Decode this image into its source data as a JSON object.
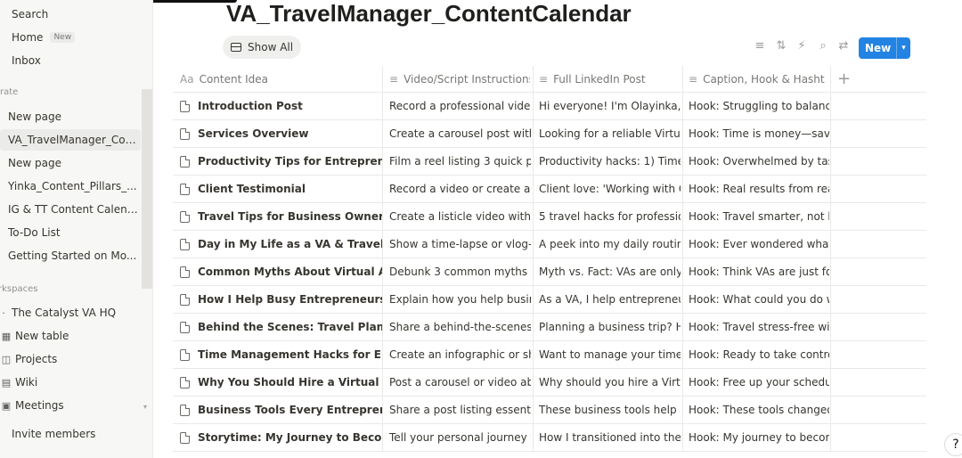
{
  "sidebar": {
    "search": "Search",
    "home": "Home",
    "home_badge": "New",
    "inbox": "Inbox",
    "private_section": "rate",
    "private_pages": [
      "New page",
      "VA_TravelManager_Con...",
      "New page",
      "Yinka_Content_Pillars_...",
      "IG & TT Content Calend...",
      "To-Do List",
      "Getting Started on Mo..."
    ],
    "workspaces_section": "rkspaces",
    "workspace_name": "The Catalyst VA HQ",
    "workspace_items": [
      {
        "label": "New table",
        "icon": "table-icon"
      },
      {
        "label": "Projects",
        "icon": "projects-icon"
      },
      {
        "label": "Wiki",
        "icon": "wiki-icon"
      },
      {
        "label": "Meetings",
        "icon": "meetings-icon"
      }
    ],
    "invite": "Invite members"
  },
  "page": {
    "title": "VA_TravelManager_ContentCalendar",
    "view_tab": "Show All",
    "new_button": "New"
  },
  "table": {
    "columns": [
      {
        "label": "Content Idea",
        "icon": "Aa"
      },
      {
        "label": "Video/Script Instructions",
        "icon": "≡"
      },
      {
        "label": "Full LinkedIn Post",
        "icon": "≡"
      },
      {
        "label": "Caption, Hook & Hasht...",
        "icon": "≡"
      }
    ],
    "rows": [
      [
        "Introduction Post",
        "Record a professional video int",
        "Hi everyone! I'm Olayinka, a de",
        "Hook: Struggling to balance wo"
      ],
      [
        "Services Overview",
        "Create a carousel post with slid",
        "Looking for a reliable Virtual As",
        "Hook: Time is money—save bo"
      ],
      [
        "Productivity Tips for Entrepreneurs",
        "Film a reel listing 3 quick produ",
        "Productivity hacks: 1) Time-bloc",
        "Hook: Overwhelmed by tasks? l"
      ],
      [
        "Client Testimonial",
        "Record a video or create a testi",
        "Client love: 'Working with Olayi",
        "Hook: Real results from real clie"
      ],
      [
        "Travel Tips for Business Owners",
        "Create a listicle video with 5 tra",
        "5 travel hacks for professionals:",
        "Hook: Travel smarter, not harde"
      ],
      [
        "Day in My Life as a VA & Travel Manage",
        "Show a time-lapse or vlog-style",
        "A peek into my daily routine as",
        "Hook: Ever wondered what a Vi"
      ],
      [
        "Common Myths About Virtual Assistant",
        "Debunk 3 common myths abou",
        "Myth vs. Fact: VAs are only for b",
        "Hook: Think VAs are just for CE"
      ],
      [
        "How I Help Busy Entrepreneurs Save Ti",
        "Explain how you help business",
        "As a VA, I help entrepreneurs sa",
        "Hook: What could you do with"
      ],
      [
        "Behind the Scenes: Travel Planning Pro",
        "Share a behind-the-scenes look",
        "Planning a business trip? Here's",
        "Hook: Travel stress-free with th"
      ],
      [
        "Time Management Hacks for Entrepren",
        "Create an infographic or short",
        "Want to manage your time bett",
        "Hook: Ready to take control of"
      ],
      [
        "Why You Should Hire a Virtual Assistan",
        "Post a carousel or video about",
        "Why should you hire a Virtual A",
        "Hook: Free up your schedule wi"
      ],
      [
        "Business Tools Every Entrepreneur Need",
        "Share a post listing essential bu",
        "These business tools help me st",
        "Hook: These tools changed my"
      ],
      [
        "Storytime: My Journey to Becoming a V",
        "Tell your personal journey to be",
        "How I transitioned into the VA",
        "Hook: My journey to becoming"
      ]
    ]
  },
  "help_glyph": "?",
  "accent_color": "#2383e2"
}
